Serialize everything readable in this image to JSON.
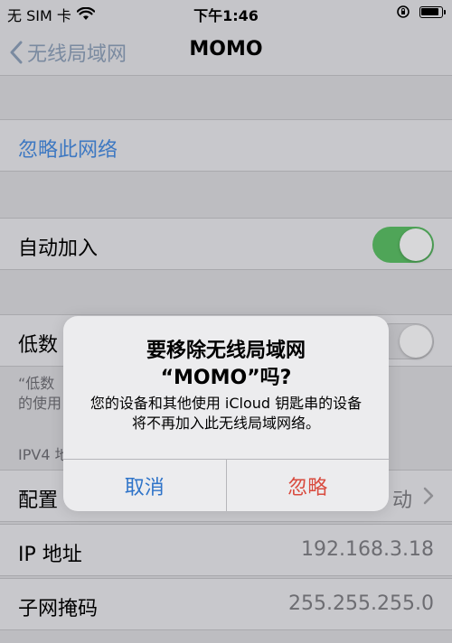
{
  "status_bar": {
    "carrier": "无 SIM 卡",
    "time": "下午1:46",
    "battery_level": 0.9
  },
  "nav": {
    "back_label": "无线局域网",
    "title": "MOMO"
  },
  "cells": {
    "forget": "忽略此网络",
    "auto_join": "自动加入",
    "auto_join_on": true,
    "low_data_prefix": "低数",
    "low_data_on": false,
    "note_line1": "“低数",
    "note_line2": "的使用",
    "ipv4_header": "IPV4 地",
    "configure_prefix": "配置",
    "configure_value_suffix": "动",
    "ip_label": "IP 地址",
    "ip_value": "192.168.3.18",
    "subnet_label": "子网掩码",
    "subnet_value": "255.255.255.0"
  },
  "alert": {
    "title_line1": "要移除无线局域网",
    "title_line2": "“MOMO”吗?",
    "message": "您的设备和其他使用 iCloud 钥匙串的设备将不再加入此无线局域网络。",
    "cancel": "取消",
    "confirm": "忽略"
  },
  "colors": {
    "link_blue": "#3d78c2",
    "toggle_green": "#4fa558",
    "destructive_red": "#d94b3f"
  }
}
